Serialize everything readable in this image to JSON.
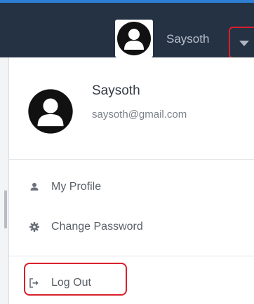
{
  "header": {
    "username": "Saysoth",
    "avatar_icon": "user-avatar-icon",
    "dropdown_icon": "caret-down-icon",
    "accent_color": "#2d7fd3",
    "background_color": "#253244"
  },
  "dropdown": {
    "user": {
      "name": "Saysoth",
      "email": "saysoth@gmail.com"
    },
    "items": [
      {
        "label": "My Profile",
        "icon": "user-icon"
      },
      {
        "label": "Change Password",
        "icon": "gear-icon"
      },
      {
        "label": "Log Out",
        "icon": "sign-out-icon"
      }
    ],
    "highlight_color": "#d81f2b"
  }
}
